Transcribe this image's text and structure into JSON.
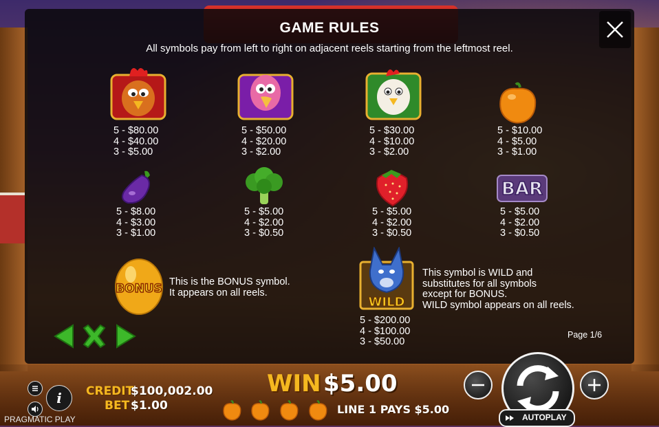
{
  "modal": {
    "title": "GAME RULES",
    "subtitle": "All symbols pay from left to right on adjacent reels starting from the leftmost reel.",
    "page_indicator": "Page 1/6"
  },
  "symbols": [
    {
      "name": "red-hen",
      "pays": [
        "5 - $80.00",
        "4 - $40.00",
        "3 - $5.00"
      ]
    },
    {
      "name": "pink-turkey",
      "pays": [
        "5 - $50.00",
        "4 - $20.00",
        "3 - $2.00"
      ]
    },
    {
      "name": "white-hen",
      "pays": [
        "5 - $30.00",
        "4 - $10.00",
        "3 - $2.00"
      ]
    },
    {
      "name": "orange-pepper",
      "pays": [
        "5 - $10.00",
        "4 - $5.00",
        "3 - $1.00"
      ]
    },
    {
      "name": "eggplant",
      "pays": [
        "5 - $8.00",
        "4 - $3.00",
        "3 - $1.00"
      ]
    },
    {
      "name": "broccoli",
      "pays": [
        "5 - $5.00",
        "4 - $2.00",
        "3 - $0.50"
      ]
    },
    {
      "name": "strawberry",
      "pays": [
        "5 - $5.00",
        "4 - $2.00",
        "3 - $0.50"
      ]
    },
    {
      "name": "bar",
      "pays": [
        "5 - $5.00",
        "4 - $2.00",
        "3 - $0.50"
      ]
    }
  ],
  "bonus": {
    "icon_text": "BONUS",
    "desc_1": "This is the BONUS symbol.",
    "desc_2": "It appears on all reels."
  },
  "wild": {
    "icon_text": "WILD",
    "desc_1": "This symbol is WILD and",
    "desc_2": "substitutes for all symbols",
    "desc_3": "except for BONUS.",
    "desc_4": "WILD symbol appears on all reels.",
    "pays": [
      "5 - $200.00",
      "4 - $100.00",
      "3 - $50.00"
    ]
  },
  "bottom": {
    "credit_label": "CREDIT",
    "credit_value": "$100,002.00",
    "bet_label": "BET",
    "bet_value": "$1.00",
    "win_label": "WIN",
    "win_value": "$5.00",
    "line_pays": "LINE 1 PAYS $5.00",
    "autoplay_label": "AUTOPLAY",
    "brand": "PRAGMATIC PLAY",
    "line_win_symbols": [
      "orange-pepper",
      "orange-pepper",
      "orange-pepper",
      "orange-pepper"
    ]
  },
  "colors": {
    "accent_gold": "#f5b820",
    "modal_bg": "#0a080a",
    "arrow_green": "#3db82a"
  }
}
